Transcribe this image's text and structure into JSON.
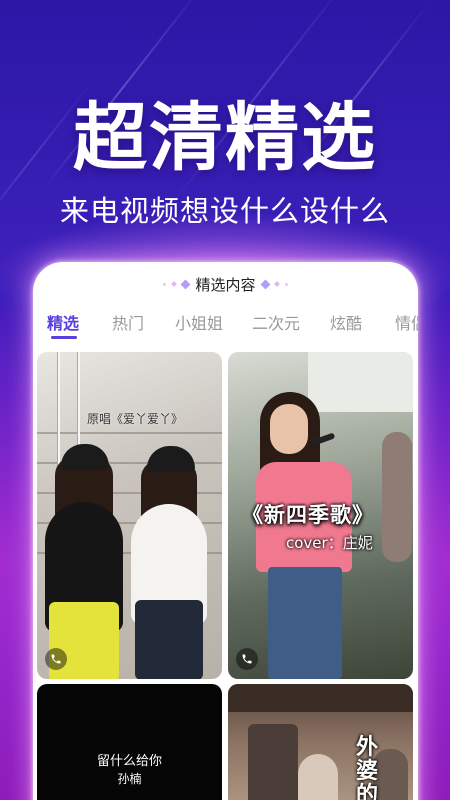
{
  "headline": "超清精选",
  "subline": "来电视频想设什么设什么",
  "card": {
    "title": "精选内容"
  },
  "tabs": [
    {
      "label": "精选",
      "active": true
    },
    {
      "label": "热门",
      "active": false
    },
    {
      "label": "小姐姐",
      "active": false
    },
    {
      "label": "二次元",
      "active": false
    },
    {
      "label": "炫酷",
      "active": false
    },
    {
      "label": "情侣",
      "active": false
    }
  ],
  "videos": [
    {
      "caption": "原唱《爱丫爱丫》"
    },
    {
      "title": "《新四季歌》",
      "subtitle": "cover：庄妮"
    },
    {
      "lyric_line1": "留什么给你",
      "lyric_line2": "孙楠"
    },
    {
      "side_text": "外婆的"
    }
  ],
  "colors": {
    "accent": "#5b3ee0",
    "bg_top": "#2b18a6",
    "bg_bottom": "#8a1ab8"
  }
}
